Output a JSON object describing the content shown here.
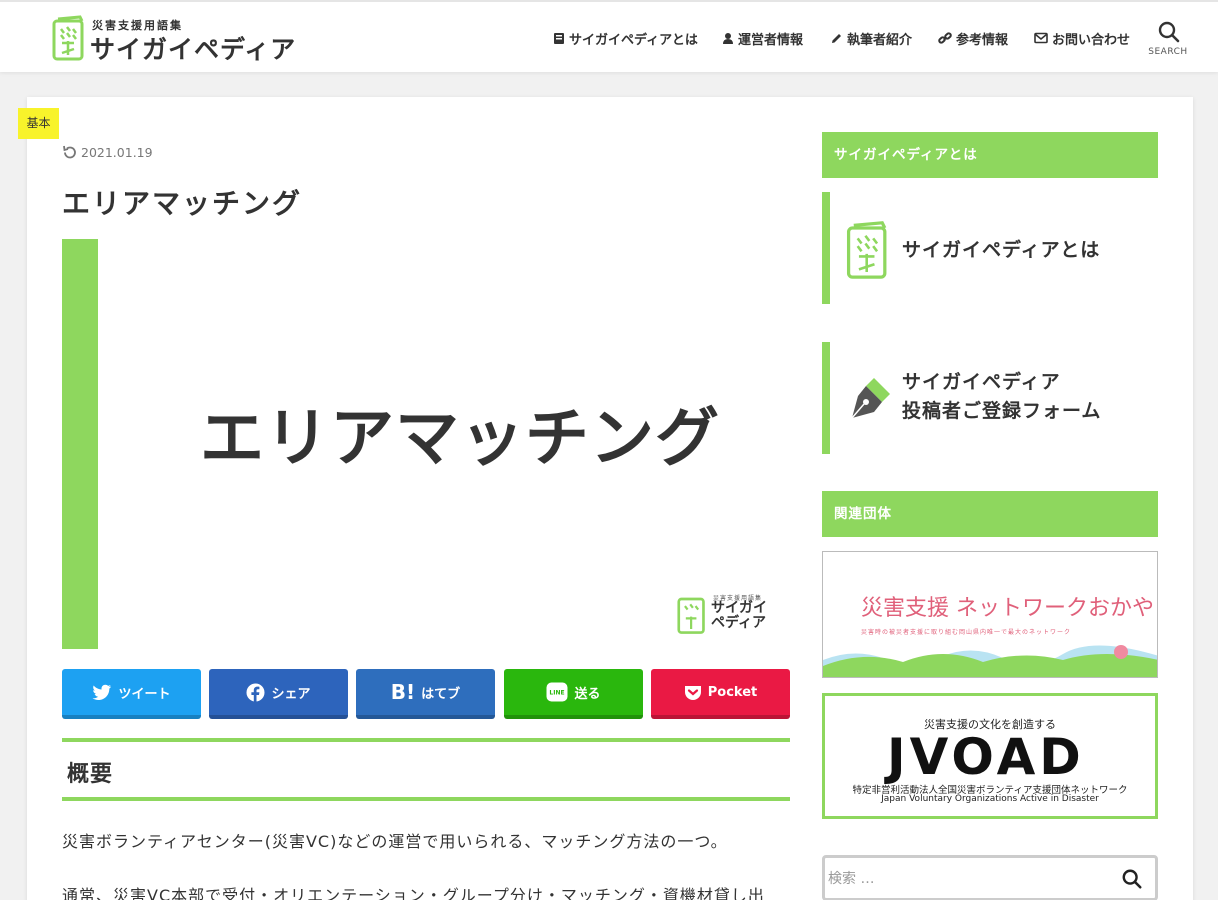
{
  "site": {
    "tagline": "災害支援用語集",
    "name": "サイガイペディア"
  },
  "nav": {
    "items": [
      {
        "label": "サイガイペディアとは",
        "icon": "book-icon"
      },
      {
        "label": "運営者情報",
        "icon": "user-icon"
      },
      {
        "label": "執筆者紹介",
        "icon": "pencil-icon"
      },
      {
        "label": "参考情報",
        "icon": "link-icon"
      },
      {
        "label": "お問い合わせ",
        "icon": "envelope-icon"
      }
    ],
    "search_label": "SEARCH"
  },
  "article": {
    "category": "基本",
    "date": "2021.01.19",
    "title": "エリアマッチング",
    "eyecatch_text": "エリアマッチング",
    "eyecatch_logo_sub": "災害支援用語集",
    "eyecatch_logo_main": "サイガイペディア",
    "section_heading": "概要",
    "paragraph1": "災害ボランティアセンター(災害VC)などの運営で用いられる、マッチング方法の一つ。",
    "paragraph2": "通常、災害VC本部で受付・オリエンテーション・グループ分け・マッチング・資機材貸し出"
  },
  "share": {
    "twitter": "ツイート",
    "facebook": "シェア",
    "hatena": "はてブ",
    "line": "送る",
    "pocket": "Pocket",
    "hatena_mark": "B!",
    "line_mark": "LINE"
  },
  "colors": {
    "accent": "#8ed75e",
    "badge": "#f8f32b",
    "twitter": "#1da1f2",
    "facebook": "#2d64bc",
    "hatena": "#2e6ebd",
    "line": "#2ab70d",
    "pocket": "#ea1944"
  },
  "sidebar": {
    "widget1_title": "サイガイペディアとは",
    "banner1_text": "サイガイペディアとは",
    "banner2_line1": "サイガイペディア",
    "banner2_line2": "投稿者ご登録フォーム",
    "widget2_title": "関連団体",
    "org1_title": "災害支援 ネットワークおかやま",
    "org1_sub": "災害時の被災者支援に取り組む岡山県内唯一で最大のネットワーク",
    "org2_tagline": "災害支援の文化を創造する",
    "org2_name": "JVOAD",
    "org2_desc_jp": "特定非営利活動法人全国災害ボランティア支援団体ネットワーク",
    "org2_desc_en": "Japan Voluntary Organizations Active in Disaster",
    "search_placeholder": "検索 …"
  }
}
